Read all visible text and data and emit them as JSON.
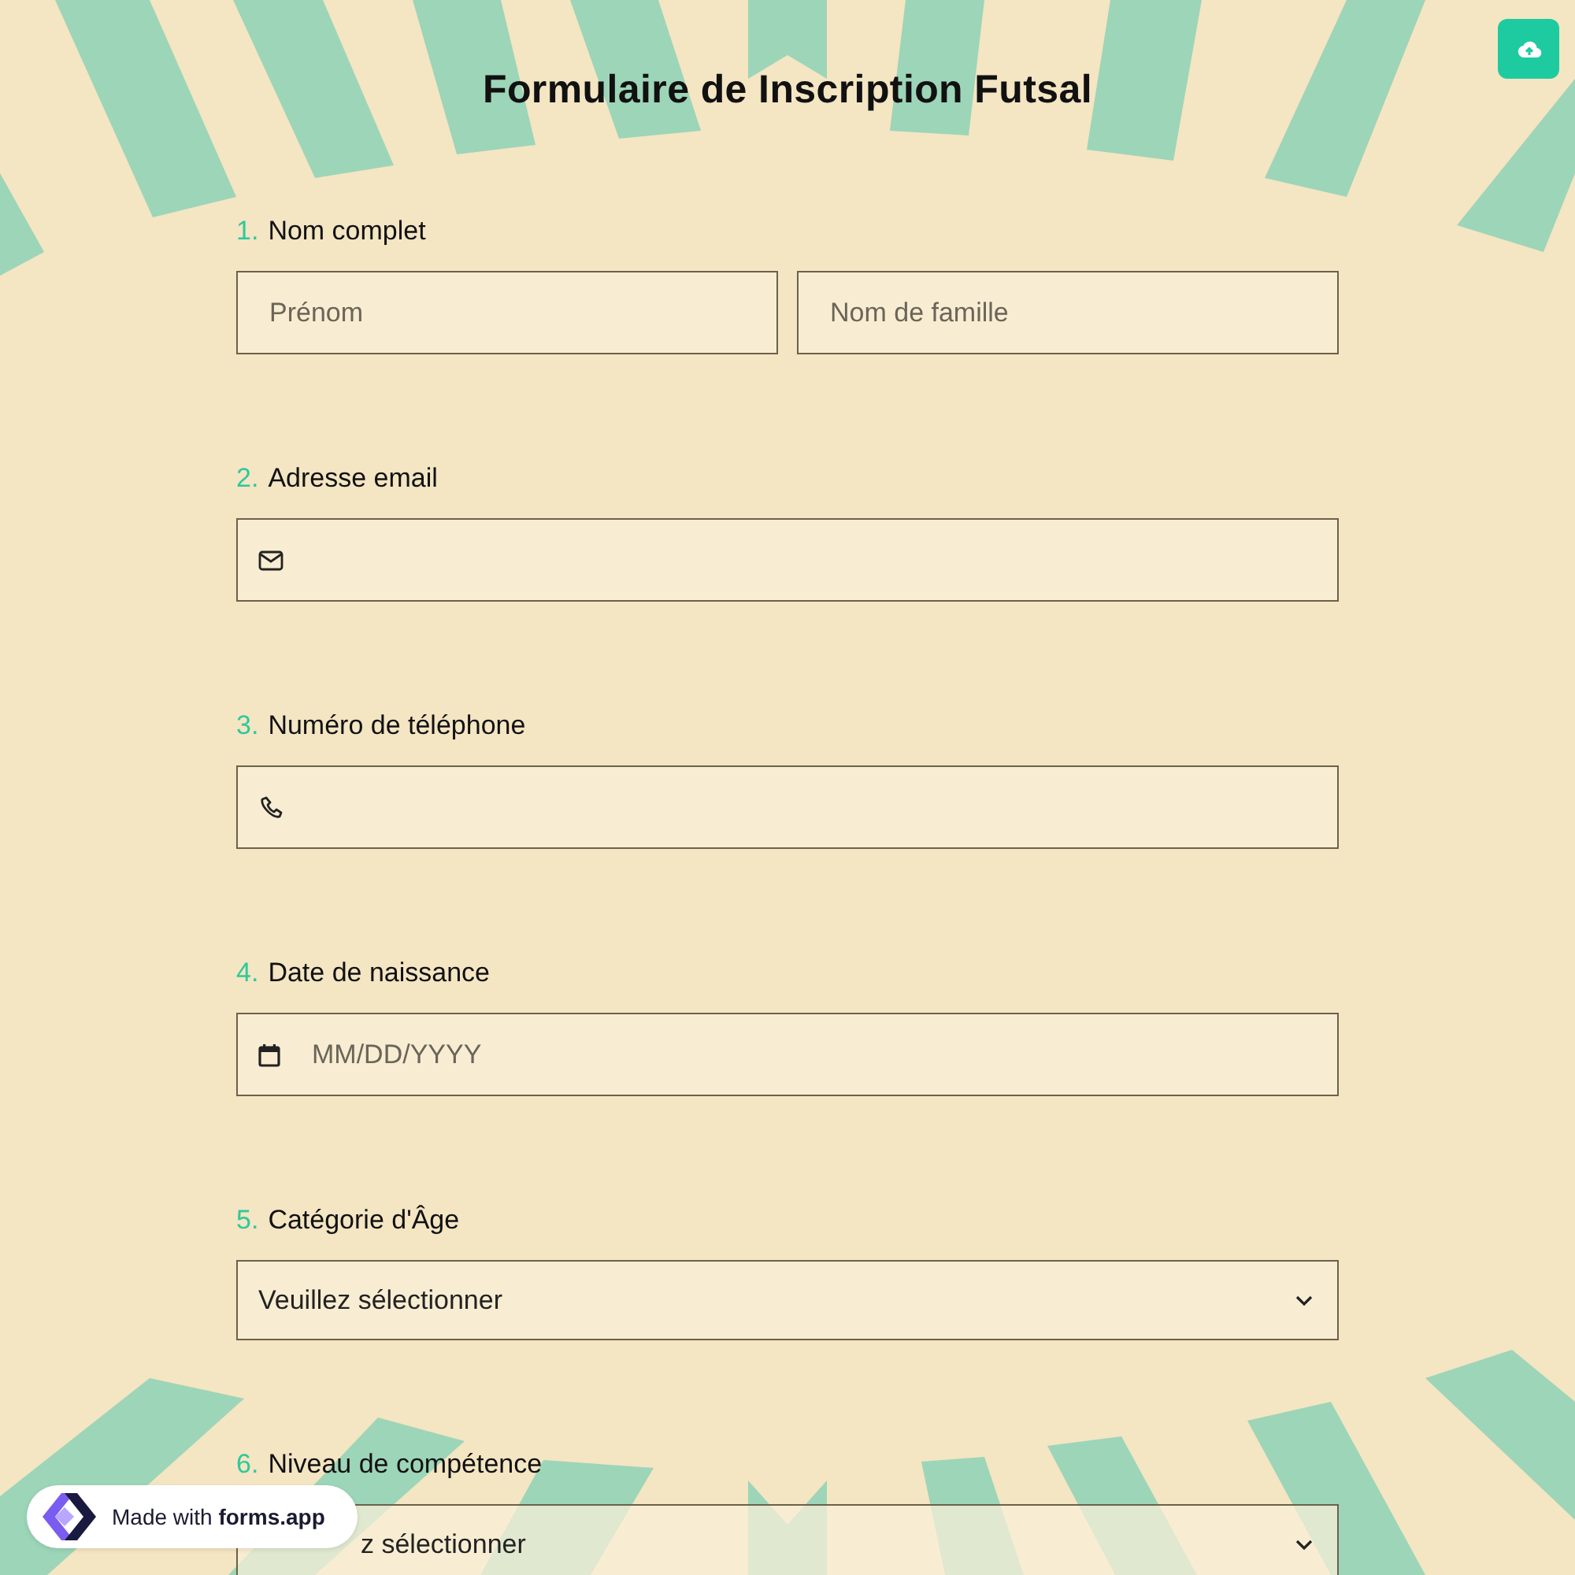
{
  "title": "Formulaire de Inscription Futsal",
  "questions": [
    {
      "number": "1.",
      "label": "Nom complet",
      "kind": "name",
      "placeholders": [
        "Prénom",
        "Nom de famille"
      ]
    },
    {
      "number": "2.",
      "label": "Adresse email",
      "kind": "email"
    },
    {
      "number": "3.",
      "label": "Numéro de téléphone",
      "kind": "phone"
    },
    {
      "number": "4.",
      "label": "Date de naissance",
      "kind": "date",
      "placeholder": "MM/DD/YYYY"
    },
    {
      "number": "5.",
      "label": "Catégorie d'Âge",
      "kind": "select",
      "value": "Veuillez sélectionner"
    },
    {
      "number": "6.",
      "label": "Niveau de compétence",
      "kind": "select",
      "value": "z sélectionner",
      "covered": true
    }
  ],
  "badge": "Made with **forms.app**"
}
